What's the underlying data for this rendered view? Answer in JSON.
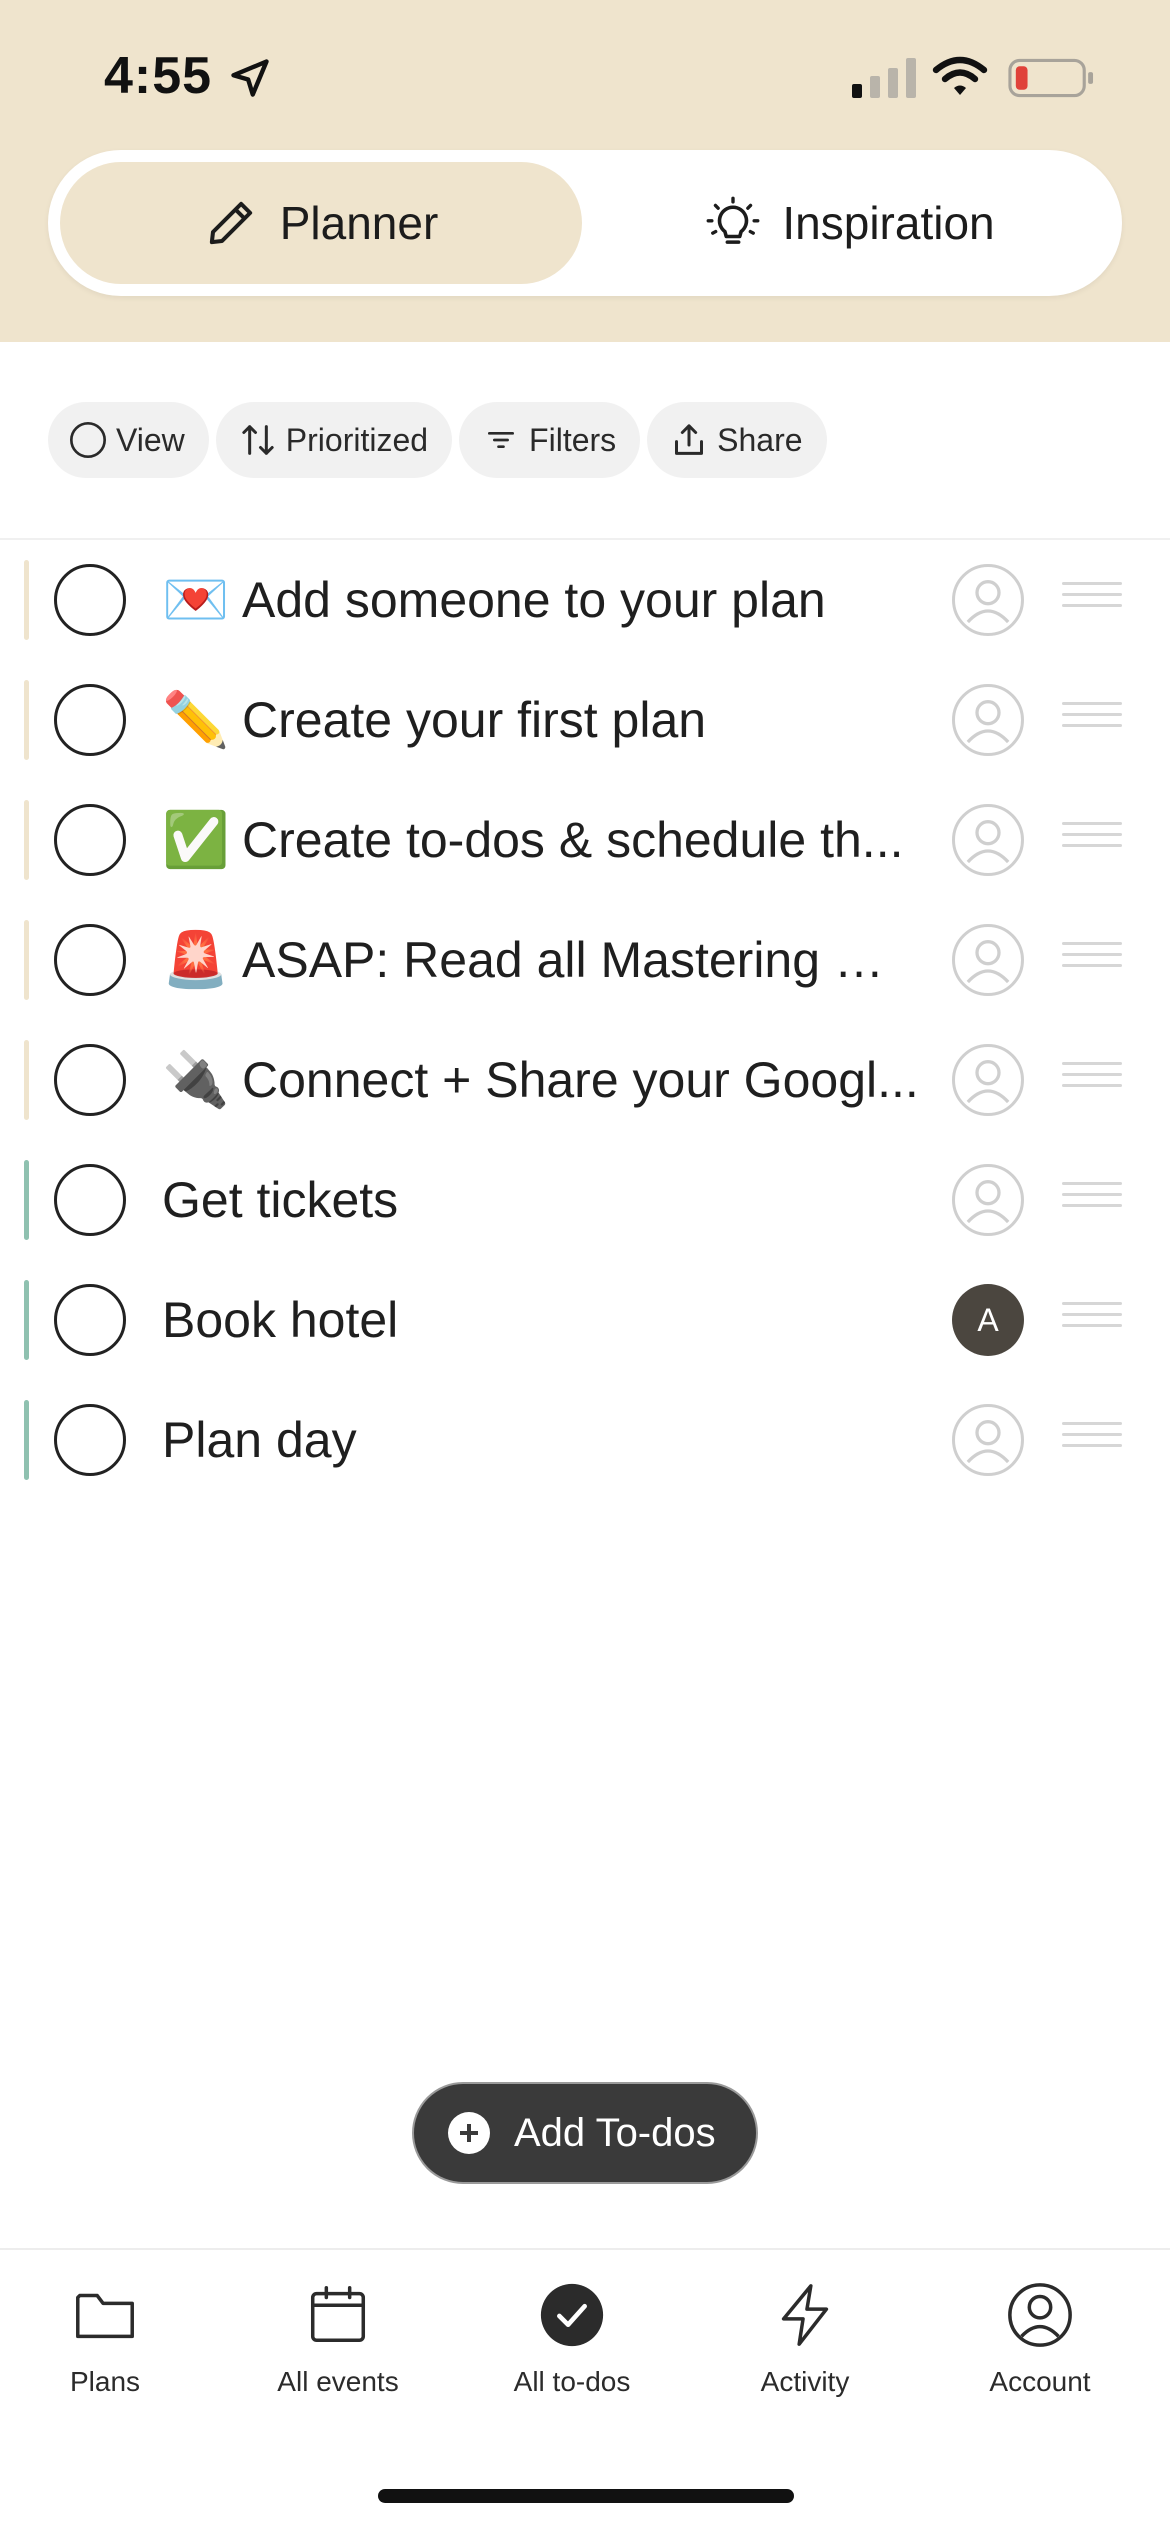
{
  "status_bar": {
    "time": "4:55"
  },
  "segmented": {
    "planner_label": "Planner",
    "inspiration_label": "Inspiration"
  },
  "toolbar": {
    "view_label": "View",
    "prioritized_label": "Prioritized",
    "filters_label": "Filters",
    "share_label": "Share"
  },
  "todos": [
    {
      "emoji": "💌",
      "title": "Add someone to your plan",
      "bar_color": "#EFE4CD",
      "assignee": ""
    },
    {
      "emoji": "✏️",
      "title": "Create your first plan",
      "bar_color": "#EFE4CD",
      "assignee": ""
    },
    {
      "emoji": "✅",
      "title": "Create to-dos & schedule th...",
      "bar_color": "#EFE4CD",
      "assignee": ""
    },
    {
      "emoji": "🚨",
      "title": "ASAP: Read all Mastering Ma...",
      "bar_color": "#EFE4CD",
      "assignee": ""
    },
    {
      "emoji": "🔌",
      "title": "Connect + Share your Googl...",
      "bar_color": "#EFE4CD",
      "assignee": ""
    },
    {
      "emoji": "",
      "title": "Get tickets",
      "bar_color": "#8FC1B0",
      "assignee": ""
    },
    {
      "emoji": "",
      "title": "Book hotel",
      "bar_color": "#8FC1B0",
      "assignee": "A"
    },
    {
      "emoji": "",
      "title": "Plan day",
      "bar_color": "#8FC1B0",
      "assignee": ""
    }
  ],
  "add_button": {
    "label": "Add To-dos"
  },
  "tabbar": {
    "plans": "Plans",
    "all_events": "All events",
    "all_todos": "All to-dos",
    "activity": "Activity",
    "account": "Account"
  },
  "colors": {
    "header_bg": "#EFE4CD",
    "accent_dark": "#3A3A3A",
    "battery_low": "#E0423A"
  }
}
